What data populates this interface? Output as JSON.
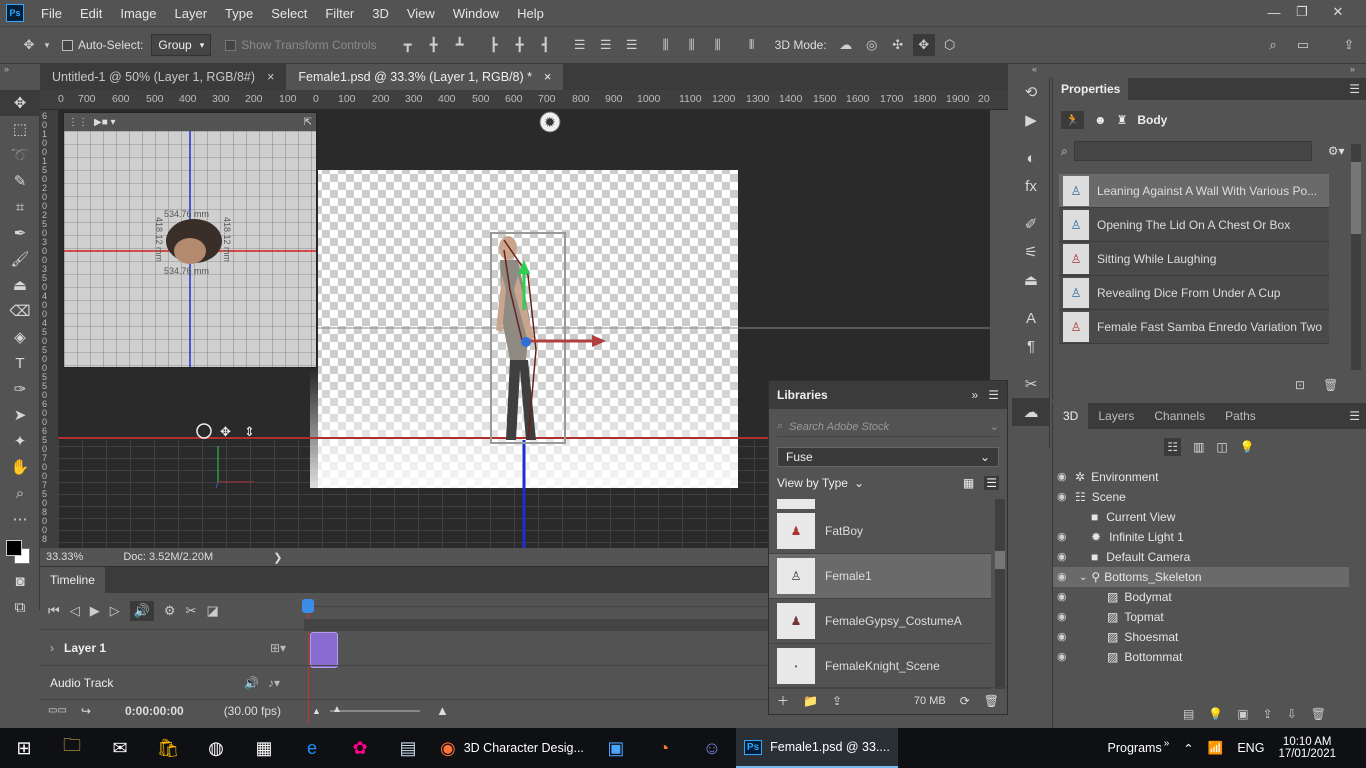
{
  "app": {
    "logo": "Ps"
  },
  "menu": [
    "File",
    "Edit",
    "Image",
    "Layer",
    "Type",
    "Select",
    "Filter",
    "3D",
    "View",
    "Window",
    "Help"
  ],
  "window_controls": {
    "minimize": "—",
    "restore": "❐",
    "close": "✕"
  },
  "options": {
    "auto_select_label": "Auto-Select:",
    "auto_select_value": "Group",
    "show_transform_label": "Show Transform Controls",
    "mode_label": "3D Mode:"
  },
  "tabs": [
    {
      "label": "Untitled-1 @ 50% (Layer 1, RGB/8#)",
      "close": "×"
    },
    {
      "label": "Female1.psd @ 33.3% (Layer 1, RGB/8) *",
      "close": "×"
    }
  ],
  "ruler_top": [
    "0",
    "700",
    "600",
    "500",
    "400",
    "300",
    "200",
    "100",
    "0",
    "100",
    "200",
    "300",
    "400",
    "500",
    "600",
    "700",
    "800",
    "900",
    "1000",
    "1100",
    "1200",
    "1300",
    "1400",
    "1500",
    "1600",
    "1700",
    "1800",
    "1900",
    "20"
  ],
  "ruler_left": [
    "6",
    "0",
    "1",
    "0",
    "0",
    "1",
    "5",
    "0",
    "2",
    "0",
    "0",
    "2",
    "5",
    "0",
    "3",
    "0",
    "0",
    "3",
    "5",
    "0",
    "4",
    "0",
    "0",
    "4",
    "5",
    "0",
    "5",
    "0",
    "0",
    "5",
    "5",
    "0",
    "6",
    "0",
    "0",
    "6",
    "5",
    "0",
    "7",
    "0",
    "0",
    "7",
    "5",
    "0",
    "8",
    "0",
    "0",
    "8"
  ],
  "secondary_view": {
    "dim_top": "534.76 mm",
    "dim_bottom": "534.76 mm",
    "dim_left": "418.12 mm",
    "dim_right": "418.12 mm"
  },
  "status": {
    "zoom": "33.33%",
    "doc": "Doc: 3.52M/2.20M",
    "arrow": "❯"
  },
  "timeline": {
    "title": "Timeline",
    "layer_label": "Layer 1",
    "audio_label": "Audio Track",
    "timecode": "0:00:00:00",
    "fps": "(30.00 fps)"
  },
  "libraries": {
    "title": "Libraries",
    "search_placeholder": "Search Adobe Stock",
    "library_select": "Fuse",
    "view_by": "View by Type",
    "items": [
      "FatBoy",
      "Female1",
      "FemaleGypsy_CostumeA",
      "FemaleKnight_Scene"
    ],
    "size": "70 MB"
  },
  "properties": {
    "title": "Properties",
    "section": "Body",
    "animations": [
      "Leaning Against A Wall With Various Po...",
      "Opening The Lid On A Chest Or Box",
      "Sitting While Laughing",
      "Revealing Dice From Under A Cup",
      "Female Fast Samba Enredo Variation Two"
    ]
  },
  "panel3d": {
    "tabs": [
      "3D",
      "Layers",
      "Channels",
      "Paths"
    ],
    "rows": [
      {
        "label": "Environment"
      },
      {
        "label": "Scene"
      },
      {
        "label": "Current View"
      },
      {
        "label": "Infinite Light 1"
      },
      {
        "label": "Default Camera"
      },
      {
        "label": "Bottoms_Skeleton"
      },
      {
        "label": "Bodymat"
      },
      {
        "label": "Topmat"
      },
      {
        "label": "Shoesmat"
      },
      {
        "label": "Bottommat"
      }
    ]
  },
  "taskbar": {
    "firefox_label": "3D Character Desig...",
    "ps_label": "Female1.psd @ 33....",
    "programs": "Programs",
    "lang": "ENG",
    "time": "10:10 AM",
    "date": "17/01/2021"
  },
  "colors": {
    "accent": "#31a8ff",
    "selected_row": "#6a6a6a",
    "taskbar": "#0e1013",
    "timeline_clip": "#8a6bd0"
  }
}
